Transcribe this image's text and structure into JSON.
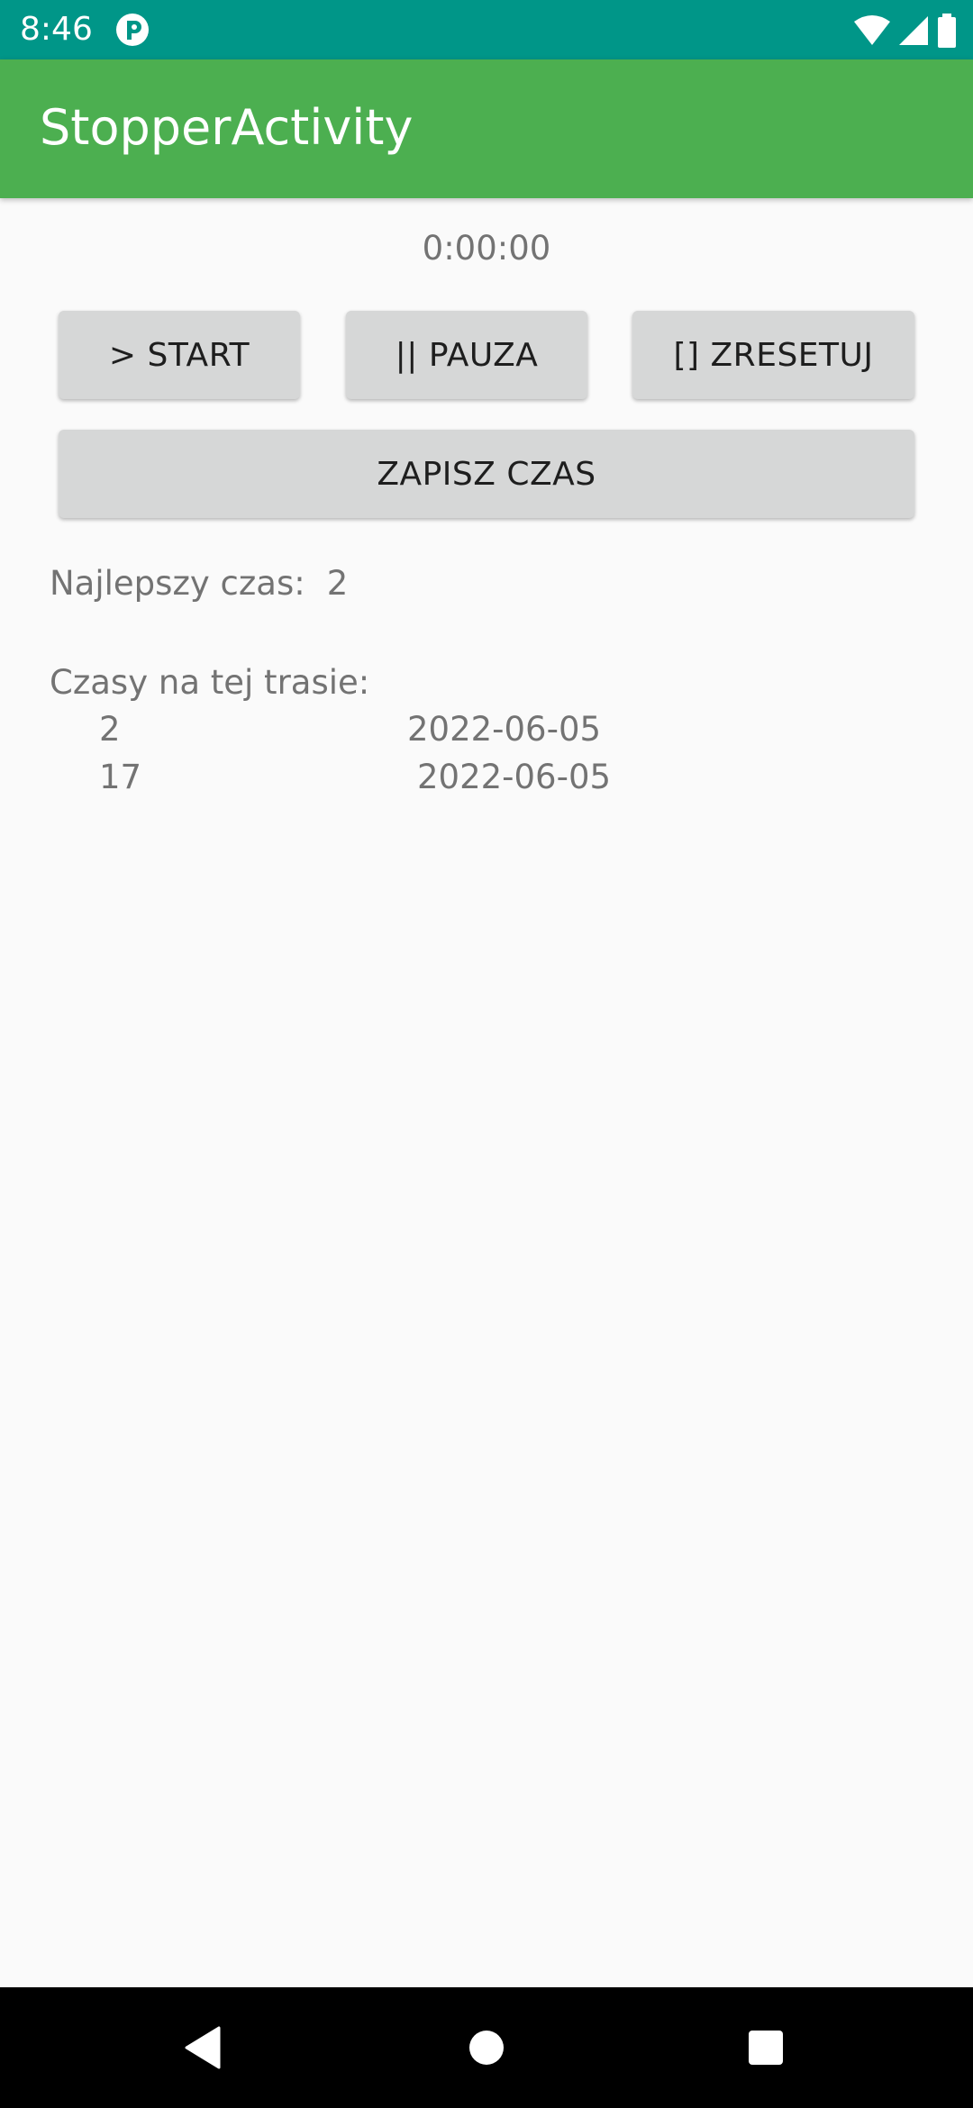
{
  "status_bar": {
    "time": "8:46",
    "icons": [
      "app-notification-icon",
      "wifi-icon",
      "signal-icon",
      "battery-icon"
    ]
  },
  "app_bar": {
    "title": "StopperActivity",
    "color": "#4caf50"
  },
  "stopwatch": {
    "time": "0:00:00"
  },
  "buttons": {
    "start": "> START",
    "pause": "|| PAUZA",
    "reset": "[] ZRESETUJ",
    "save": "ZAPISZ CZAS"
  },
  "best": {
    "label": "Najlepszy czas:",
    "value": "2"
  },
  "times": {
    "label": "Czasy na tej trasie:",
    "entries": [
      {
        "value": "2",
        "date": "2022-06-05"
      },
      {
        "value": "17",
        "date": "2022-06-05"
      }
    ]
  },
  "nav": {
    "icons": [
      "back-icon",
      "home-icon",
      "recents-icon"
    ]
  },
  "colors": {
    "status_bar": "#009688",
    "app_bar": "#4caf50",
    "button": "#d6d7d7"
  }
}
